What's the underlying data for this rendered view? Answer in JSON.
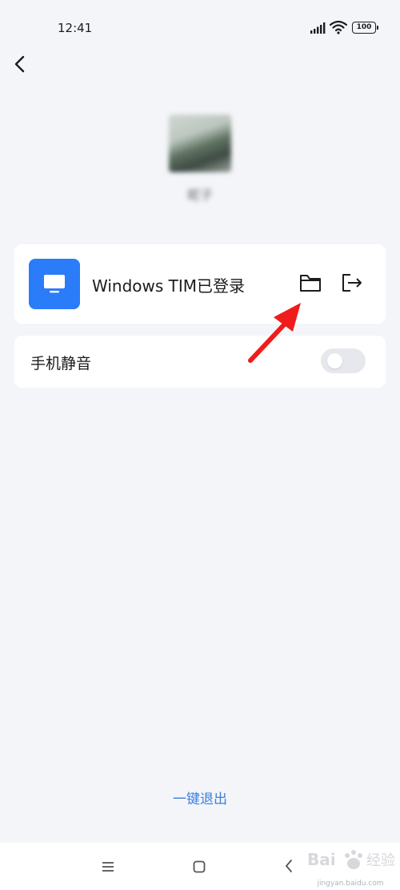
{
  "status_bar": {
    "time": "12:41",
    "battery": "100"
  },
  "profile": {
    "nickname": "昵子"
  },
  "device_card": {
    "label": "Windows TIM已登录"
  },
  "mute_card": {
    "label": "手机静音",
    "toggle_on": false
  },
  "footer": {
    "logout_all_label": "一键退出"
  },
  "watermark": {
    "text": "jingyan.baidu.com"
  },
  "colors": {
    "accent": "#2b7cf8",
    "link": "#3c7fe0",
    "background": "#f4f5f9",
    "annotation_arrow": "#f01b1b"
  }
}
